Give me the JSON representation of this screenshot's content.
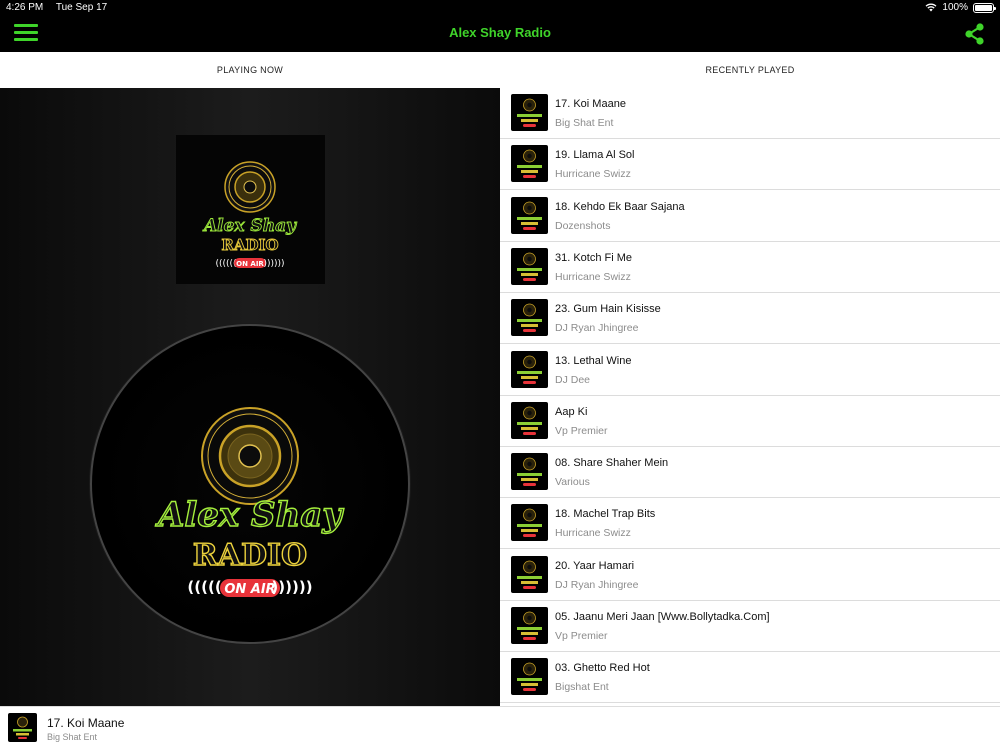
{
  "status_bar": {
    "time": "4:26 PM",
    "date": "Tue Sep 17",
    "battery": "100%",
    "wifi_icon": "wifi-icon",
    "battery_icon": "battery-icon"
  },
  "header": {
    "title": "Alex Shay Radio",
    "menu_icon": "hamburger-menu-icon",
    "share_icon": "share-icon",
    "accent_color": "#3fd42a"
  },
  "tabs": [
    {
      "label": "PLAYING NOW"
    },
    {
      "label": "RECENTLY PLAYED"
    }
  ],
  "station_logo": {
    "line1": "Alex Shay",
    "line2": "RADIO",
    "badge": "ON AIR"
  },
  "recently_played": [
    {
      "title": "17. Koi Maane",
      "artist": "Big Shat Ent"
    },
    {
      "title": "19. Llama Al Sol",
      "artist": "Hurricane Swizz"
    },
    {
      "title": "18. Kehdo Ek Baar Sajana",
      "artist": "Dozenshots"
    },
    {
      "title": "31. Kotch Fi Me",
      "artist": "Hurricane Swizz"
    },
    {
      "title": "23. Gum Hain Kisisse",
      "artist": "DJ Ryan Jhingree"
    },
    {
      "title": "13. Lethal Wine",
      "artist": "DJ Dee"
    },
    {
      "title": "Aap Ki",
      "artist": "Vp Premier"
    },
    {
      "title": "08. Share Shaher Mein",
      "artist": "Various"
    },
    {
      "title": "18. Machel Trap Bits",
      "artist": "Hurricane Swizz"
    },
    {
      "title": "20. Yaar Hamari",
      "artist": "DJ Ryan Jhingree"
    },
    {
      "title": "05. Jaanu Meri Jaan [Www.Bollytadka.Com]",
      "artist": "Vp Premier"
    },
    {
      "title": "03. Ghetto Red Hot",
      "artist": "Bigshat Ent"
    }
  ],
  "now_playing": {
    "title": "17. Koi Maane",
    "artist": "Big Shat Ent"
  }
}
